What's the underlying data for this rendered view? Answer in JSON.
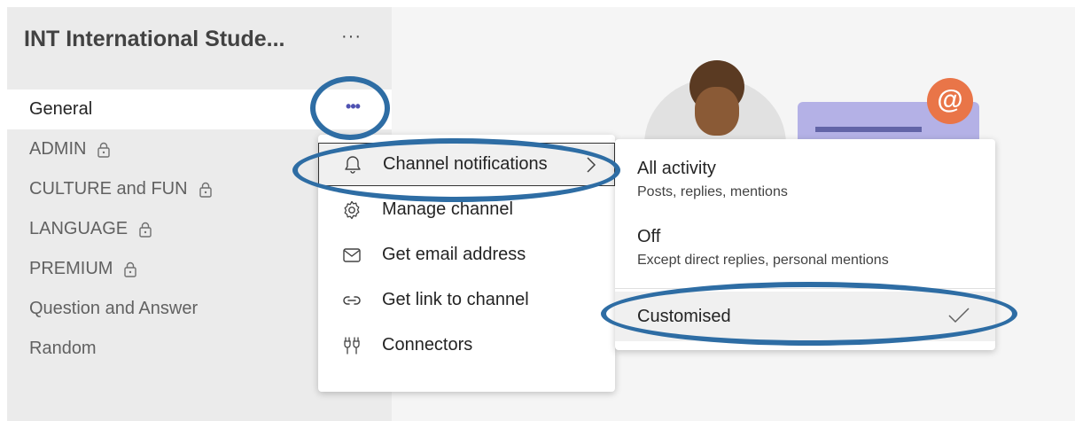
{
  "team": {
    "name": "INT International Stude...",
    "more_label": "···"
  },
  "channels": [
    {
      "label": "General",
      "locked": false
    },
    {
      "label": "ADMIN",
      "locked": true
    },
    {
      "label": "CULTURE and FUN",
      "locked": true
    },
    {
      "label": "LANGUAGE",
      "locked": true
    },
    {
      "label": "PREMIUM",
      "locked": true
    },
    {
      "label": "Question and Answer",
      "locked": false
    },
    {
      "label": "Random",
      "locked": false
    }
  ],
  "channel_more_label": "•••",
  "menu": {
    "items": [
      {
        "label": "Channel notifications",
        "icon": "bell-icon",
        "has_submenu": true
      },
      {
        "label": "Manage channel",
        "icon": "gear-icon"
      },
      {
        "label": "Get email address",
        "icon": "envelope-icon"
      },
      {
        "label": "Get link to channel",
        "icon": "link-icon"
      },
      {
        "label": "Connectors",
        "icon": "connectors-icon"
      }
    ]
  },
  "submenu": {
    "options": [
      {
        "title": "All activity",
        "description": "Posts, replies, mentions"
      },
      {
        "title": "Off",
        "description": "Except direct replies, personal mentions"
      },
      {
        "title": "Customised",
        "selected": true
      }
    ]
  },
  "illustration": {
    "at_symbol": "@"
  },
  "colors": {
    "accent": "#4f52b2",
    "annotation": "#2e6da4",
    "sidebar_bg": "#ebebeb",
    "selected_bg": "#ffffff"
  }
}
